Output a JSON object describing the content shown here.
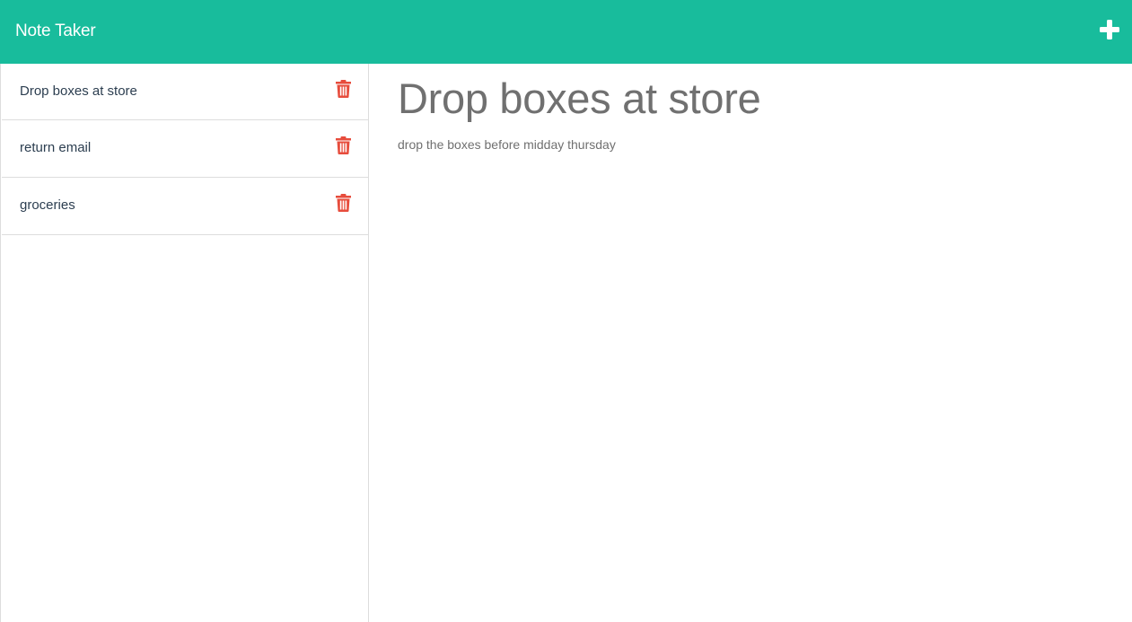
{
  "header": {
    "title": "Note Taker",
    "new_note_icon": "plus-icon",
    "background_color": "#18bc9c"
  },
  "sidebar": {
    "notes": [
      {
        "title": "Drop boxes at store",
        "delete_icon": "trash-icon"
      },
      {
        "title": "return email",
        "delete_icon": "trash-icon"
      },
      {
        "title": "groceries",
        "delete_icon": "trash-icon"
      }
    ],
    "delete_icon_color": "#e74c3c"
  },
  "main": {
    "note_title": "Drop boxes at store",
    "note_text": "drop the boxes before midday thursday"
  }
}
